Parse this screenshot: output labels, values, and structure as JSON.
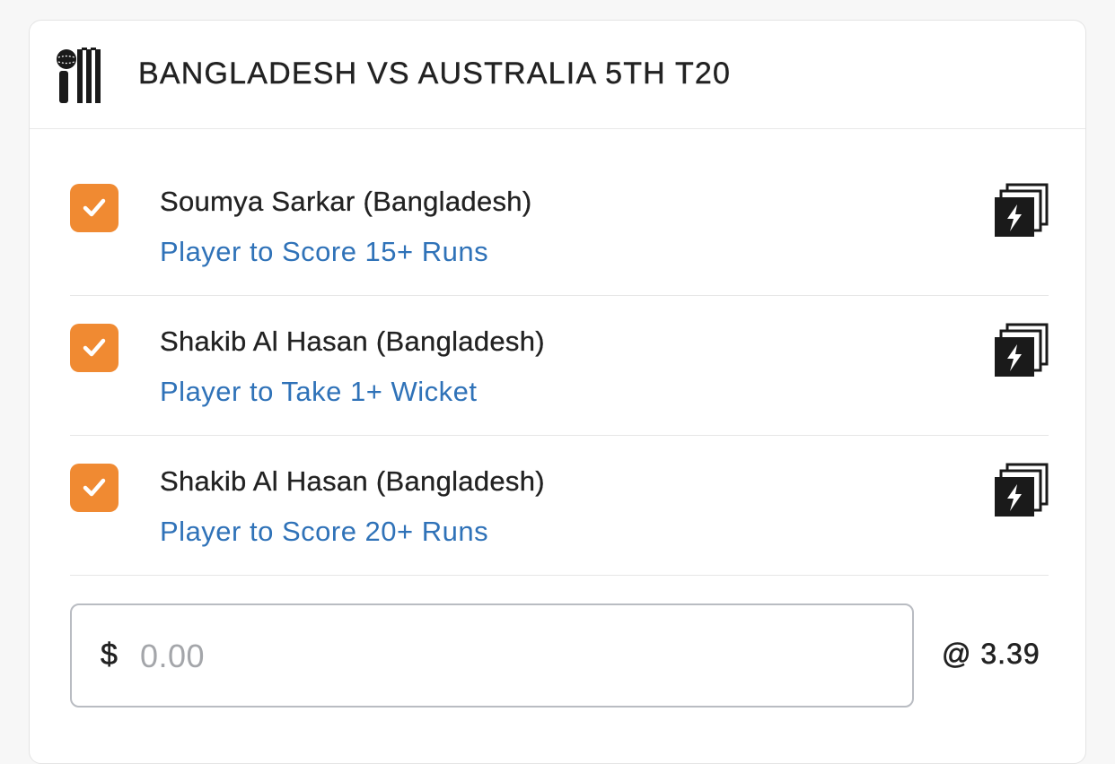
{
  "header": {
    "title": "BANGLADESH VS AUSTRALIA 5TH T20",
    "icon": "cricket-bat-ball-icon"
  },
  "legs": [
    {
      "player": "Soumya Sarkar (Bangladesh)",
      "market": "Player to Score 15+ Runs",
      "checked": true
    },
    {
      "player": "Shakib Al Hasan (Bangladesh)",
      "market": "Player to Take 1+ Wicket",
      "checked": true
    },
    {
      "player": "Shakib Al Hasan (Bangladesh)",
      "market": "Player to Score 20+ Runs",
      "checked": true
    }
  ],
  "stake": {
    "currency": "$",
    "placeholder": "0.00",
    "value": ""
  },
  "odds": "@ 3.39",
  "colors": {
    "accent": "#f08a32",
    "market_link": "#2f72b8",
    "text": "#222222"
  }
}
